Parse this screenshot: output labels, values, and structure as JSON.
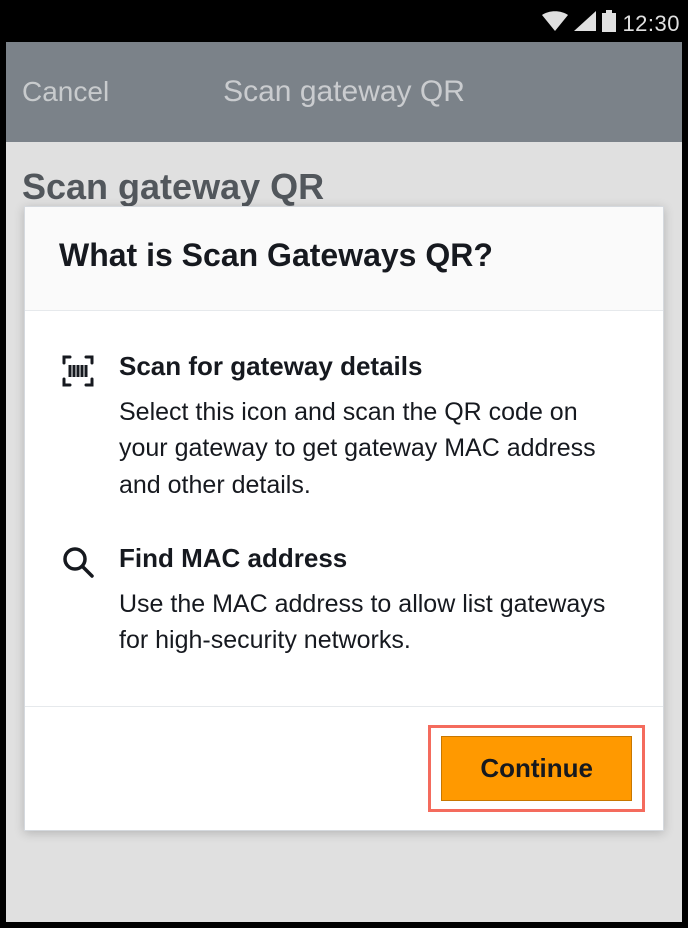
{
  "status": {
    "time": "12:30"
  },
  "nav": {
    "cancel": "Cancel",
    "title": "Scan gateway QR"
  },
  "page": {
    "title": "Scan gateway QR"
  },
  "modal": {
    "title": "What is Scan Gateways QR?",
    "items": [
      {
        "title": "Scan for gateway details",
        "desc": "Select this icon and scan the QR code on your gateway to get gateway MAC address and other details."
      },
      {
        "title": "Find MAC address",
        "desc": "Use the MAC address to allow list gateways for high-security networks."
      }
    ],
    "continue": "Continue"
  }
}
